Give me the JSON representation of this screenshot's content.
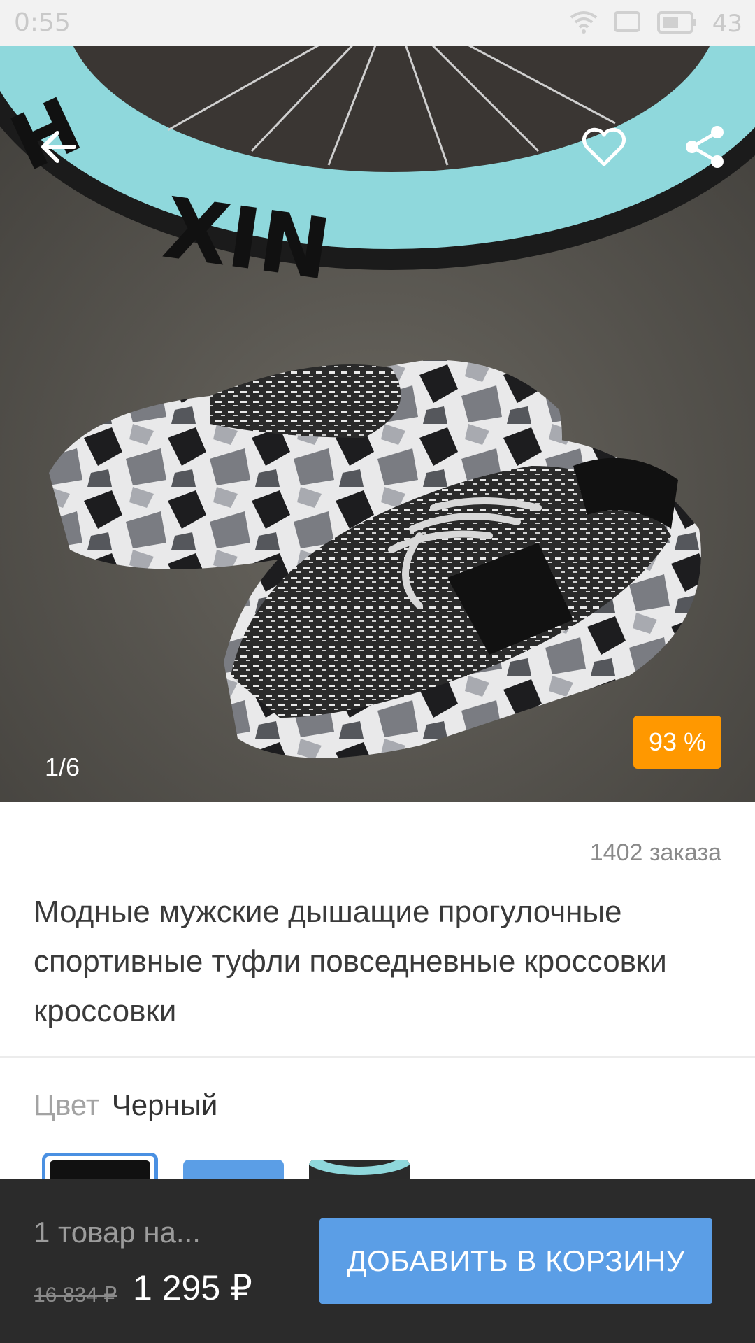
{
  "status_bar": {
    "time": "0:55",
    "battery_percent": "43",
    "icons": [
      "wifi-icon",
      "screen-cast-icon",
      "battery-icon"
    ]
  },
  "header": {
    "back_icon": "arrow-left-icon",
    "favorite_icon": "heart-outline-icon",
    "share_icon": "share-icon"
  },
  "gallery": {
    "counter": "1/6",
    "discount_badge": "93 %",
    "badge_color": "#ff9800",
    "current_image": 1,
    "total_images": 6
  },
  "product": {
    "orders": "1402 заказа",
    "title": "Модные мужские дышащие прогулочные спортивные туфли повседневные кроссовки кроссовки",
    "color_label": "Цвет",
    "color_value": "Черный",
    "color_options": [
      {
        "name": "black",
        "selected": true
      },
      {
        "name": "blue",
        "selected": false
      },
      {
        "name": "photo",
        "selected": false
      }
    ]
  },
  "cart_bar": {
    "quantity_text": "1 товар на...",
    "old_price": "16 834 ₽",
    "new_price": "1 295 ₽",
    "add_button": "ДОБАВИТЬ В КОРЗИНУ",
    "accent_color": "#5b9ee6"
  }
}
